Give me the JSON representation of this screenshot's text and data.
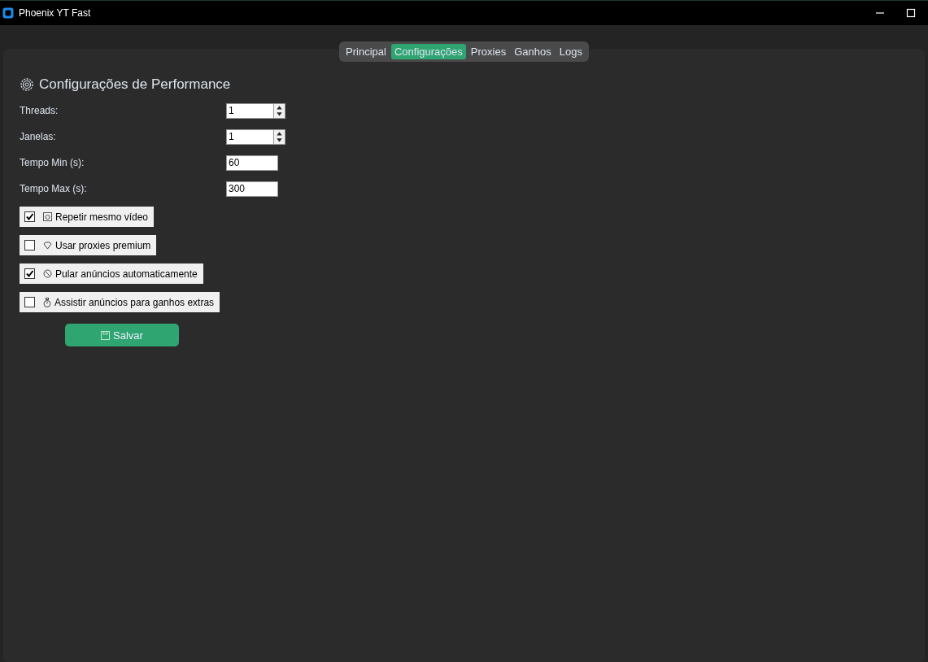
{
  "window": {
    "title": "Phoenix YT Fast"
  },
  "tabs": [
    {
      "label": "Principal",
      "selected": false
    },
    {
      "label": "Configurações",
      "selected": true
    },
    {
      "label": "Proxies",
      "selected": false
    },
    {
      "label": "Ganhos",
      "selected": false
    },
    {
      "label": "Logs",
      "selected": false
    }
  ],
  "section": {
    "title": "Configurações de Performance"
  },
  "fields": [
    {
      "label": "Threads:",
      "kind": "spin",
      "value": "1"
    },
    {
      "label": "Janelas:",
      "kind": "spin",
      "value": "1"
    },
    {
      "label": "Tempo Min (s):",
      "kind": "entry",
      "value": "60"
    },
    {
      "label": "Tempo Max (s):",
      "kind": "entry",
      "value": "300"
    }
  ],
  "options": [
    {
      "label": "Repetir mesmo vídeo",
      "checked": true
    },
    {
      "label": "Usar proxies premium",
      "checked": false
    },
    {
      "label": "Pular anúncios automaticamente",
      "checked": true
    },
    {
      "label": "Assistir anúncios para ganhos extras",
      "checked": false
    }
  ],
  "save_button": {
    "label": "Salvar"
  }
}
